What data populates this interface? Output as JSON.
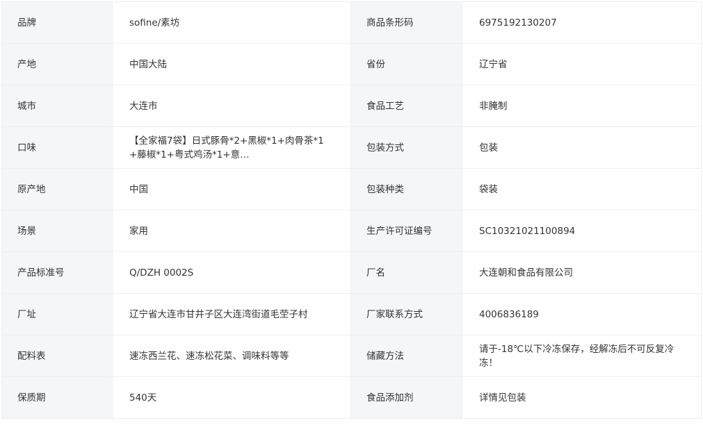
{
  "rows": [
    {
      "k1": "品牌",
      "v1": "sofine/素坊",
      "k2": "商品条形码",
      "v2": "6975192130207"
    },
    {
      "k1": "产地",
      "v1": "中国大陆",
      "k2": "省份",
      "v2": "辽宁省"
    },
    {
      "k1": "城市",
      "v1": "大连市",
      "k2": "食品工艺",
      "v2": "非腌制"
    },
    {
      "k1": "口味",
      "v1": "【全家福7袋】日式豚骨*2+黑椒*1+肉骨茶*1+藤椒*1+粤式鸡汤*1+意…",
      "k2": "包装方式",
      "v2": "包装"
    },
    {
      "k1": "原产地",
      "v1": "中国",
      "k2": "包装种类",
      "v2": "袋装"
    },
    {
      "k1": "场景",
      "v1": "家用",
      "k2": "生产许可证编号",
      "v2": "SC10321021100894"
    },
    {
      "k1": "产品标准号",
      "v1": "Q/DZH 0002S",
      "k2": "厂名",
      "v2": "大连朝和食品有限公司"
    },
    {
      "k1": "厂址",
      "v1": "辽宁省大连市甘井子区大连湾街道毛茔子村",
      "k2": "厂家联系方式",
      "v2": "4006836189"
    },
    {
      "k1": "配料表",
      "v1": "速冻西兰花、速冻松花菜、调味料等等",
      "k2": "储藏方法",
      "v2": "请于-18℃以下冷冻保存，经解冻后不可反复冷冻！"
    },
    {
      "k1": "保质期",
      "v1": "540天",
      "k2": "食品添加剂",
      "v2": "详情见包装"
    }
  ]
}
